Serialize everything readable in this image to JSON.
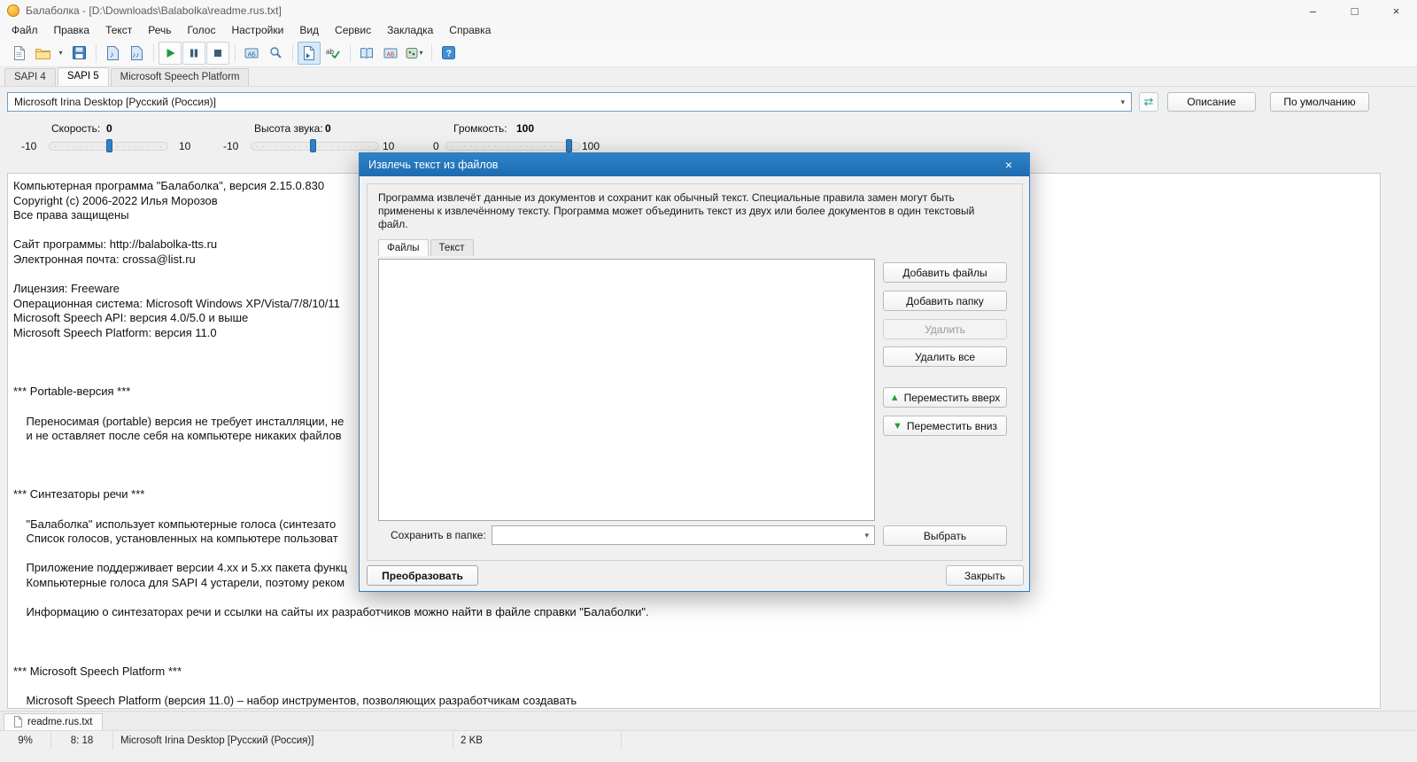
{
  "window": {
    "title": "Балаболка - [D:\\Downloads\\Balabolka\\readme.rus.txt]"
  },
  "icons": {
    "minimize": "–",
    "maximize": "□",
    "close": "×",
    "dropdown_arrow": "▾",
    "combo_arrow": "▾",
    "refresh": "⇄",
    "up_arrow": "▲",
    "down_arrow": "▼",
    "dialog_close": "×"
  },
  "menu": {
    "items": [
      "Файл",
      "Правка",
      "Текст",
      "Речь",
      "Голос",
      "Настройки",
      "Вид",
      "Сервис",
      "Закладка",
      "Справка"
    ]
  },
  "toolbar": {
    "buttons": [
      "new-file",
      "open-file",
      "open-file-menu",
      "save-file",
      "save-audio-file",
      "split-audio",
      "play",
      "pause",
      "stop",
      "search",
      "magnifier",
      "extract-text",
      "spellcheck",
      "dictionary",
      "pronunciation",
      "skins-menu",
      "help"
    ],
    "active": "extract-text"
  },
  "tabs": {
    "items": [
      "SAPI 4",
      "SAPI 5",
      "Microsoft Speech Platform"
    ],
    "active": "SAPI 5"
  },
  "voice": {
    "selected": "Microsoft Irina Desktop [Русский (Россия)]",
    "description_button": "Описание",
    "default_button": "По умолчанию"
  },
  "sliders": {
    "speed": {
      "label": "Скорость:",
      "value": "0",
      "min": "-10",
      "max": "10"
    },
    "pitch": {
      "label": "Высота звука:",
      "value": "0",
      "min": "-10",
      "max": "10"
    },
    "volume": {
      "label": "Громкость:",
      "value": "100",
      "min": "0",
      "max": "100"
    }
  },
  "document": {
    "text": "Компьютерная программа \"Балаболка\", версия 2.15.0.830\nCopyright (c) 2006-2022 Илья Морозов\nВсе права защищены\n\nСайт программы: http://balabolka-tts.ru\nЭлектронная почта: crossa@list.ru\n\nЛицензия: Freeware\nОперационная система: Microsoft Windows XP/Vista/7/8/10/11\nMicrosoft Speech API: версия 4.0/5.0 и выше\nMicrosoft Speech Platform: версия 11.0\n\n\n\n*** Portable-версия ***\n\n    Переносимая (portable) версия не требует инсталляции, не\n    и не оставляет после себя на компьютере никаких файлов\n\n\n\n*** Синтезаторы речи ***\n\n    \"Балаболка\" использует компьютерные голоса (синтезато\n    Список голосов, установленных на компьютере пользоват\n\n    Приложение поддерживает версии 4.xx и 5.xx пакета функц\n    Компьютерные голоса для SAPI 4 устарели, поэтому реком\n\n    Информацию о синтезаторах речи и ссылки на сайты их разработчиков можно найти в файле справки \"Балаболки\".\n\n\n\n*** Microsoft Speech Platform ***\n\n    Microsoft Speech Platform (версия 11.0) – набор инструментов, позволяющих разработчикам создавать"
  },
  "dialog": {
    "title": "Извлечь текст из файлов",
    "description": "Программа извлечёт данные из документов и сохранит как обычный текст. Специальные правила замен могут быть применены к извлечённому тексту. Программа может объединить текст из двух или более документов в один текстовый файл.",
    "tabs": [
      "Файлы",
      "Текст"
    ],
    "buttons": {
      "add_files": "Добавить файлы",
      "add_folder": "Добавить папку",
      "delete": "Удалить",
      "delete_all": "Удалить все",
      "move_up": "Переместить вверх",
      "move_down": "Переместить вниз",
      "choose": "Выбрать",
      "convert": "Преобразовать",
      "close": "Закрыть"
    },
    "save_label": "Сохранить в папке:"
  },
  "file_tab": {
    "name": "readme.rus.txt"
  },
  "status": {
    "progress": "9%",
    "position": "8: 18",
    "voice": "Microsoft Irina Desktop [Русский (Россия)]",
    "size": "2 KB"
  }
}
